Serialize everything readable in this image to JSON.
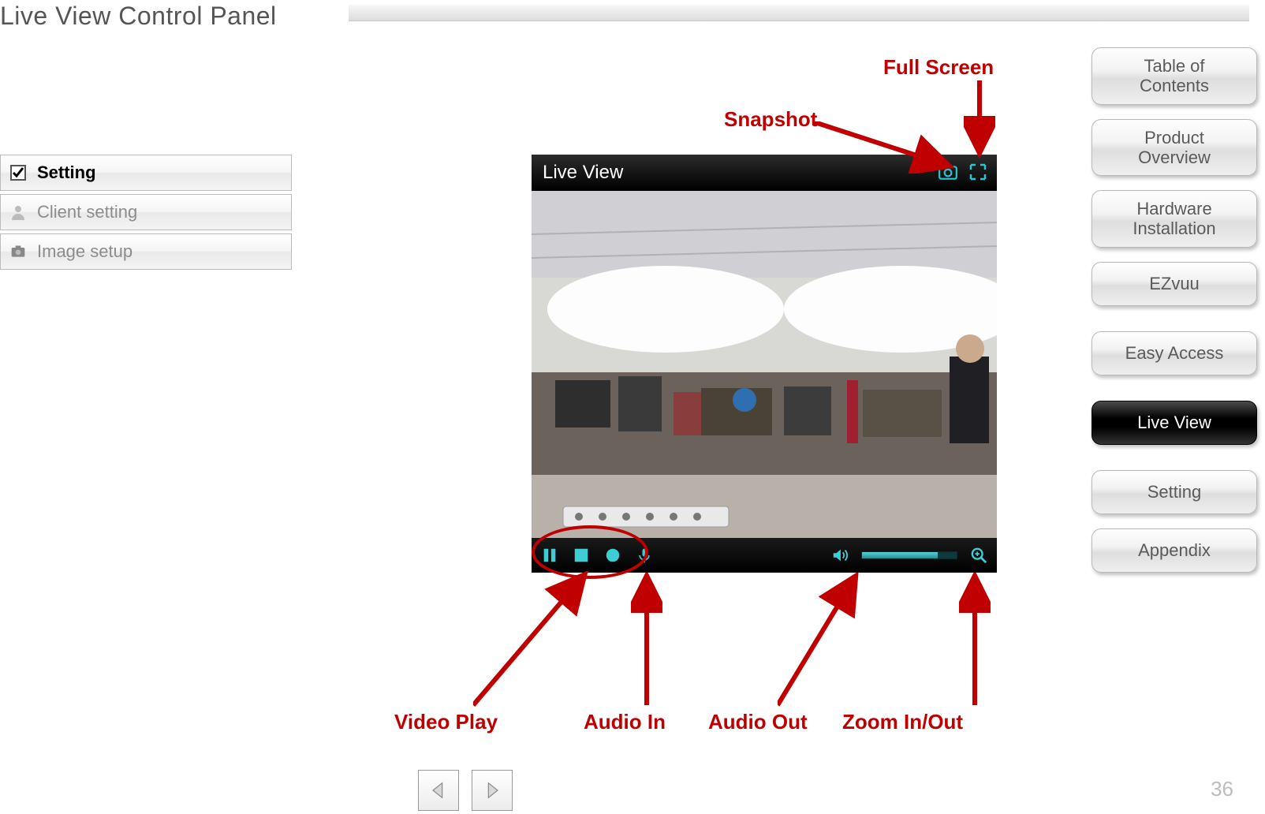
{
  "page": {
    "title": "Live View Control Panel",
    "number": "36"
  },
  "left_menu": {
    "items": [
      {
        "label": "Setting",
        "icon": "check-icon"
      },
      {
        "label": "Client setting",
        "icon": "person-icon"
      },
      {
        "label": "Image setup",
        "icon": "camera-small-icon"
      }
    ]
  },
  "right_nav": {
    "items": [
      {
        "label": "Table of\nContents",
        "active": false
      },
      {
        "label": "Product\nOverview",
        "active": false
      },
      {
        "label": "Hardware\nInstallation",
        "active": false
      },
      {
        "label": "EZvuu",
        "active": false
      },
      {
        "label": "Easy Access",
        "active": false
      },
      {
        "label": "Live View",
        "active": true
      },
      {
        "label": "Setting",
        "active": false
      },
      {
        "label": "Appendix",
        "active": false
      }
    ]
  },
  "live_view": {
    "title": "Live View"
  },
  "annotations": {
    "snapshot": "Snapshot",
    "fullscreen": "Full Screen",
    "video_play": "Video Play",
    "audio_in": "Audio In",
    "audio_out": "Audio Out",
    "zoom": "Zoom In/Out"
  }
}
